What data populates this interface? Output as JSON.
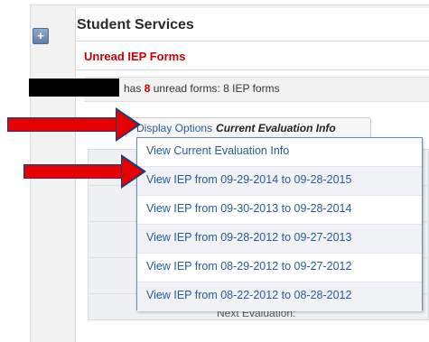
{
  "section": {
    "expand_symbol": "+",
    "title": "Student Services",
    "subheader": "Unread IEP Forms"
  },
  "unread": {
    "text_before": "has",
    "count": "8",
    "text_after": "unread forms: 8 IEP forms"
  },
  "display_options": {
    "label": "Display Options",
    "current_value": "Current Evaluation Info"
  },
  "dropdown": {
    "items": [
      "View Current Evaluation Info",
      "View IEP from 09-29-2014 to 09-28-2015",
      "View IEP from 09-30-2013 to 09-28-2014",
      "View IEP from 09-28-2012 to 09-27-2013",
      "View IEP from 08-29-2012 to 09-27-2012",
      "View IEP from 08-22-2012 to 08-28-2012"
    ]
  },
  "background": {
    "partial_label": "Next Evaluation:"
  },
  "annotation": {
    "arrow_fill": "#e60000",
    "arrow_outline": "#1f3b74"
  }
}
